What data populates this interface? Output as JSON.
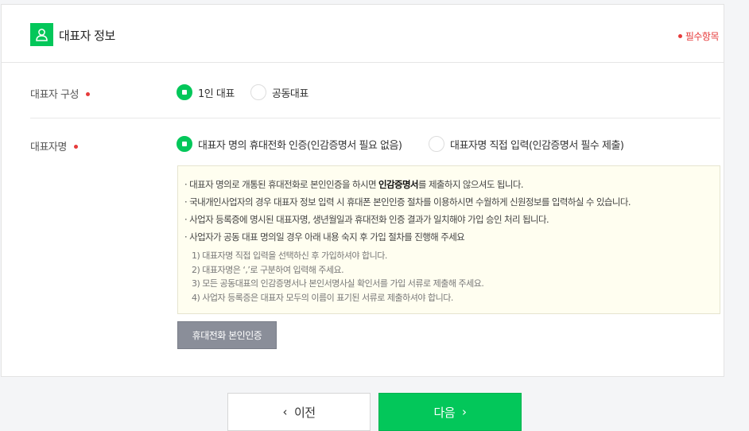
{
  "header": {
    "title": "대표자 정보",
    "required_text": "필수항목"
  },
  "composition": {
    "label": "대표자 구성",
    "options": [
      {
        "label": "1인 대표",
        "selected": true
      },
      {
        "label": "공동대표",
        "selected": false
      }
    ]
  },
  "name_section": {
    "label": "대표자명",
    "options": [
      {
        "label": "대표자 명의 휴대전화 인증(인감증명서 필요 없음)",
        "selected": true
      },
      {
        "label": "대표자명 직접 입력(인감증명서 필수 제출)",
        "selected": false
      }
    ]
  },
  "notice": {
    "line1_pre": "· 대표자 명의로 개통된 휴대전화로 본인인증을 하시면 ",
    "line1_bold": "인감증명서",
    "line1_post": "를 제출하지 않으셔도 됩니다.",
    "line2": "· 국내개인사업자의 경우 대표자 정보 입력 시 휴대폰 본인인증 절차를 이용하시면 수월하게 신원정보를 입력하실 수 있습니다.",
    "line3": "· 사업자 등록증에 명시된 대표자명, 생년월일과 휴대전화 인증 결과가 일치해야 가입 승인 처리 됩니다.",
    "line4": "· 사업자가 공동 대표 명의일 경우 아래 내용 숙지 후 가입 절차를 진행해 주세요",
    "sub": [
      "1) 대표자명 직접 입력을 선택하신 후 가입하셔야 합니다.",
      "2) 대표자명은 ‘,’로 구분하여 입력해 주세요.",
      "3) 모든 공동대표의 인감증명서나 본인서명사실 확인서를 가입 서류로 제출해 주세요.",
      "4) 사업자 등록증은 대표자 모두의 이름이 표기된 서류로 제출하셔야 합니다."
    ]
  },
  "verify_button": "휴대전화 본인인증",
  "nav": {
    "prev": "이전",
    "prev_chevron": "‹",
    "next": "다음",
    "next_chevron": "›"
  },
  "colors": {
    "accent": "#03c75a",
    "required": "#e63b3b",
    "notice_bg": "#fffef0",
    "button_gray": "#8a8e99"
  },
  "icons": {
    "header": "user-icon"
  }
}
